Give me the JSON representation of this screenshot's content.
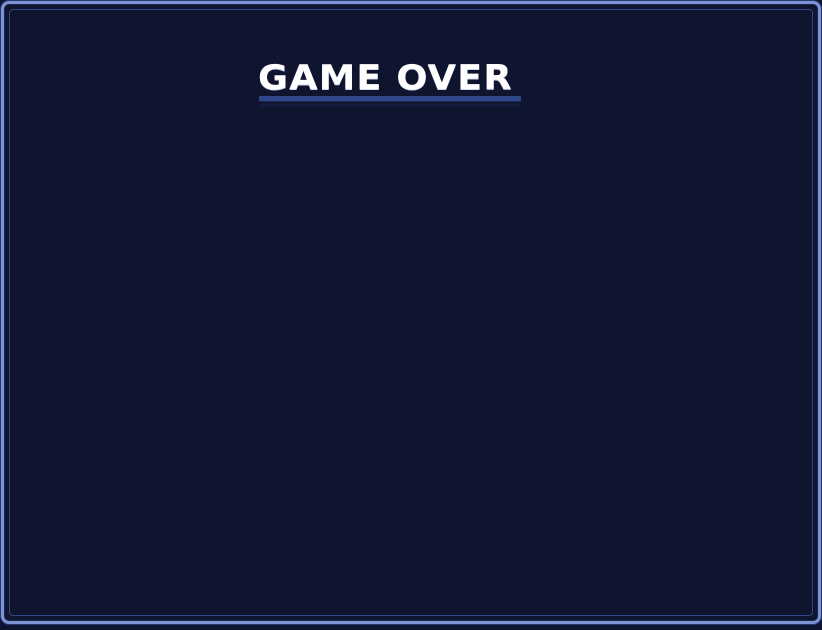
{
  "screen": {
    "title": "GAME OVER"
  },
  "colors": {
    "background": "#0f1530",
    "frame": "#7d93d6",
    "title_text": "#ffffff",
    "title_underline": "#2f4689"
  }
}
